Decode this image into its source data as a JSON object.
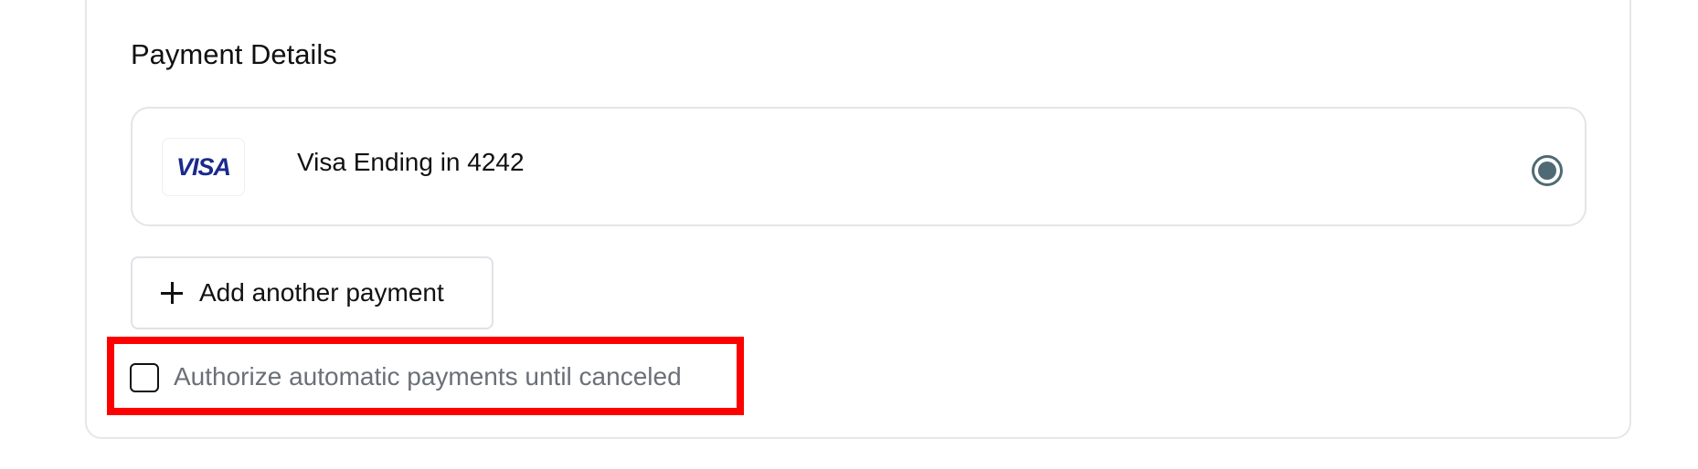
{
  "payment_details": {
    "title": "Payment Details",
    "saved_card": {
      "brand": "VISA",
      "label": "Visa Ending in 4242",
      "selected": true
    },
    "add_payment_label": "Add another payment",
    "authorize_checkbox": {
      "label": "Authorize automatic payments until canceled",
      "checked": false
    }
  },
  "colors": {
    "visa_blue": "#1a2a8c",
    "radio_accent": "#4f6a74",
    "highlight_red": "#ff0000"
  }
}
